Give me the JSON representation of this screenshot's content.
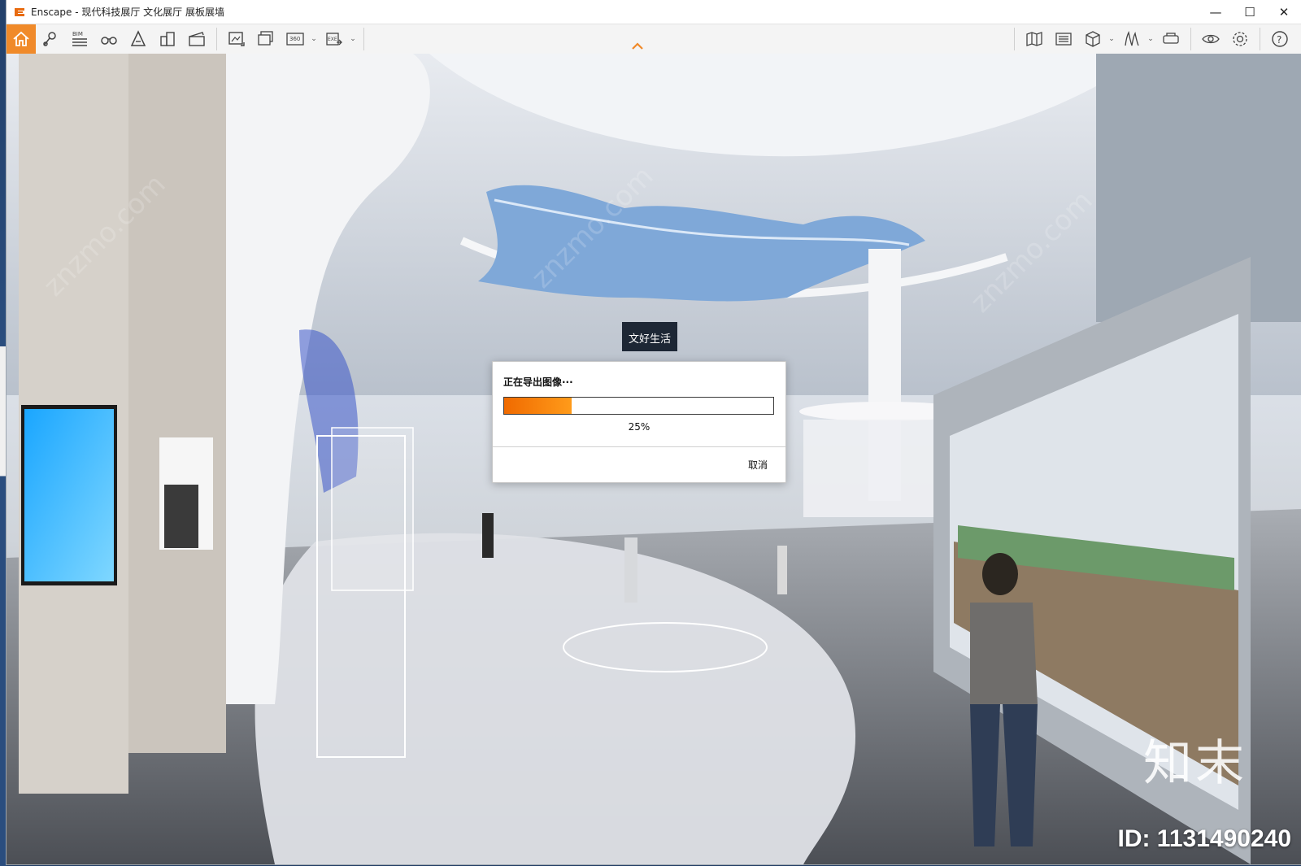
{
  "window": {
    "title": "Enscape - 现代科技展厅 文化展厅 展板展墙",
    "brand_color": "#f08a2a"
  },
  "controls": {
    "minimize": "—",
    "maximize": "☐",
    "close": "✕"
  },
  "toolbar": {
    "left": [
      {
        "name": "home-icon",
        "active": true
      },
      {
        "name": "location-icon"
      },
      {
        "name": "bim-icon",
        "label": "BIM"
      },
      {
        "name": "binoculars-icon"
      },
      {
        "name": "sketch-mode-icon"
      },
      {
        "name": "buildings-icon"
      },
      {
        "name": "clapboard-icon"
      },
      {
        "name": "screenshot-icon"
      },
      {
        "name": "batch-render-icon"
      },
      {
        "name": "panorama-360-icon",
        "label": "360"
      },
      {
        "name": "export-exe-icon",
        "label": "EXE"
      }
    ],
    "right": [
      {
        "name": "map-icon"
      },
      {
        "name": "asset-library-icon"
      },
      {
        "name": "cube-view-icon"
      },
      {
        "name": "grass-icon"
      },
      {
        "name": "vr-headset-icon"
      },
      {
        "name": "eye-icon"
      },
      {
        "name": "settings-gear-icon"
      },
      {
        "name": "help-icon"
      }
    ]
  },
  "dialog": {
    "title": "正在导出图像···",
    "progress": 0.25,
    "percent_text": "25%",
    "cancel_label": "取消",
    "progress_color": "#f06a00"
  },
  "scene": {
    "watermark_brand": "知末",
    "watermark_id": "ID: 1131490240",
    "sign_text": "文好生活"
  }
}
